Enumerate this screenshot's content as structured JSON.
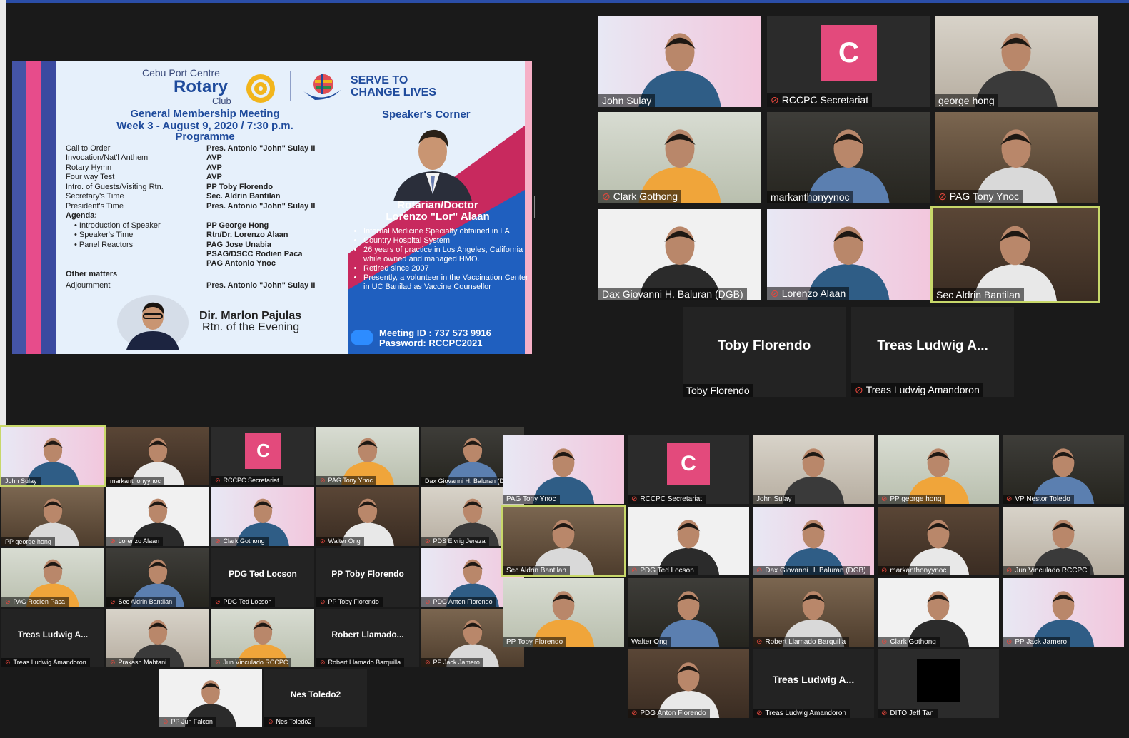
{
  "slide": {
    "club_top": "Cebu Port Centre",
    "club_rotary": "Rotary",
    "club_club": "Club",
    "serve_line1": "SERVE TO",
    "serve_line2": "CHANGE LIVES",
    "meeting_title": "General Membership Meeting",
    "meeting_week": "Week 3 - August 9, 2020 / 7:30 p.m.",
    "programme": "Programme",
    "program_rows": [
      {
        "label": "Call to Order",
        "value": "Pres. Antonio \"John\" Sulay II"
      },
      {
        "label": "Invocation/Nat'l Anthem",
        "value": "AVP"
      },
      {
        "label": "Rotary Hymn",
        "value": "AVP"
      },
      {
        "label": "Four way Test",
        "value": "AVP"
      },
      {
        "label": "Intro. of Guests/Visiting Rtn.",
        "value": "PP Toby Florendo"
      },
      {
        "label": "Secretary's Time",
        "value": "Sec. Aldrin Bantilan"
      },
      {
        "label": "President's Time",
        "value": "Pres. Antonio \"John\" Sulay II"
      },
      {
        "label": "Agenda:",
        "value": ""
      },
      {
        "label": "• Introduction of Speaker",
        "value": "PP George Hong"
      },
      {
        "label": "• Speaker's Time",
        "value": "Rtn/Dr. Lorenzo Alaan"
      },
      {
        "label": "• Panel Reactors",
        "value": "PAG Jose Unabia"
      },
      {
        "label": "",
        "value": "PSAG/DSCC Rodien Paca"
      },
      {
        "label": "",
        "value": "PAG Antonio Ynoc"
      },
      {
        "label": "Other matters",
        "value": ""
      },
      {
        "label": "Adjournment",
        "value": "Pres. Antonio \"John\" Sulay II"
      }
    ],
    "speakers_corner": "Speaker's Corner",
    "speaker_title1": "Rotarian/Doctor",
    "speaker_title2": "Lorenzo \"Lor\" Alaan",
    "speaker_bullets": [
      "Internal Medicine Specialty obtained in LA",
      "Country Hospital System",
      "26 years of practice in Los Angeles, California while owned and managed HMO.",
      "Retired since 2007",
      "Presently, a volunteer in the Vaccination Center in UC Banilad as Vaccine Counsellor"
    ],
    "meeting_id": "Meeting ID : 737 573 9916",
    "password": "Password: RCCPC2021",
    "evening_name": "Dir. Marlon Pajulas",
    "evening_sub": "Rtn. of the Evening"
  },
  "right_gallery": [
    {
      "name": "John Sulay",
      "muted": false
    },
    {
      "name": "RCCPC Secretariat",
      "muted": true,
      "initial": "C"
    },
    {
      "name": "george hong",
      "muted": false
    },
    {
      "name": "Clark Gothong",
      "muted": true
    },
    {
      "name": "markanthonyynoc",
      "muted": false
    },
    {
      "name": "PAG Tony Ynoc",
      "muted": true
    },
    {
      "name": "Dax Giovanni H. Baluran (DGB)",
      "muted": false
    },
    {
      "name": "Lorenzo Alaan",
      "muted": true
    },
    {
      "name": "Sec Aldrin Bantilan",
      "muted": false
    },
    {
      "name": "Toby Florendo",
      "muted": false,
      "center": "Toby Florendo"
    },
    {
      "name": "Treas Ludwig Amandoron",
      "muted": true,
      "center": "Treas Ludwig A..."
    }
  ],
  "left_gallery": [
    {
      "name": "John Sulay",
      "muted": false
    },
    {
      "name": "markanthonyynoc",
      "muted": false
    },
    {
      "name": "RCCPC Secretariat",
      "muted": true,
      "initial": "C"
    },
    {
      "name": "PAG Tony Ynoc",
      "muted": true
    },
    {
      "name": "Dax Giovanni H. Baluran (D",
      "muted": false
    },
    {
      "name": "PP george hong",
      "muted": false
    },
    {
      "name": "Lorenzo Alaan",
      "muted": true
    },
    {
      "name": "Clark Gothong",
      "muted": true
    },
    {
      "name": "Walter Ong",
      "muted": true
    },
    {
      "name": "PDS Elvrig Jereza",
      "muted": true
    },
    {
      "name": "PAG Rodien Paca",
      "muted": true
    },
    {
      "name": "Sec Aldrin Bantilan",
      "muted": true
    },
    {
      "name": "PDG Ted Locson",
      "muted": true,
      "center": "PDG Ted Locson"
    },
    {
      "name": "PP Toby Florendo",
      "muted": true,
      "center": "PP Toby Florendo"
    },
    {
      "name": "PDG Anton Florendo",
      "muted": true
    },
    {
      "name": "Treas Ludwig Amandoron",
      "muted": true,
      "center": "Treas Ludwig A..."
    },
    {
      "name": "Prakash Mahtani",
      "muted": true
    },
    {
      "name": "Jun Vinculado RCCPC",
      "muted": true
    },
    {
      "name": "Robert Llamado Barquilla",
      "muted": true,
      "center": "Robert Llamado..."
    },
    {
      "name": "PP Jack Jamero",
      "muted": true
    },
    {
      "name": "PP Jun Falcon",
      "muted": true
    },
    {
      "name": "Nes Toledo2",
      "muted": true,
      "center": "Nes Toledo2"
    }
  ],
  "right_bottom_gallery": [
    {
      "name": "PAG Tony Ynoc",
      "muted": false
    },
    {
      "name": "RCCPC Secretariat",
      "muted": true,
      "initial": "C"
    },
    {
      "name": "John Sulay",
      "muted": false
    },
    {
      "name": "PP george hong",
      "muted": true
    },
    {
      "name": "VP Nestor Toledo",
      "muted": true
    },
    {
      "name": "Sec Aldrin Bantilan",
      "muted": false
    },
    {
      "name": "PDG Ted Locson",
      "muted": true
    },
    {
      "name": "Dax Giovanni H. Baluran (DGB)",
      "muted": true
    },
    {
      "name": "markanthonyynoc",
      "muted": true
    },
    {
      "name": "Jun Vinculado RCCPC",
      "muted": true
    },
    {
      "name": "PP Toby Florendo",
      "muted": false
    },
    {
      "name": "Walter Ong",
      "muted": false
    },
    {
      "name": "Robert Llamado Barquilla",
      "muted": true
    },
    {
      "name": "Clark Gothong",
      "muted": true
    },
    {
      "name": "PP Jack Jamero",
      "muted": true
    },
    {
      "name": "PDG Anton Florendo",
      "muted": true
    },
    {
      "name": "Treas Ludwig Amandoron",
      "muted": true,
      "center": "Treas Ludwig A..."
    },
    {
      "name": "DITO Jeff Tan",
      "muted": true
    }
  ],
  "colors": {
    "accent": "#2b4ea8",
    "active_border": "#c8d86a",
    "muted_icon": "#e8483d",
    "secretariat": "#e34a7c"
  }
}
